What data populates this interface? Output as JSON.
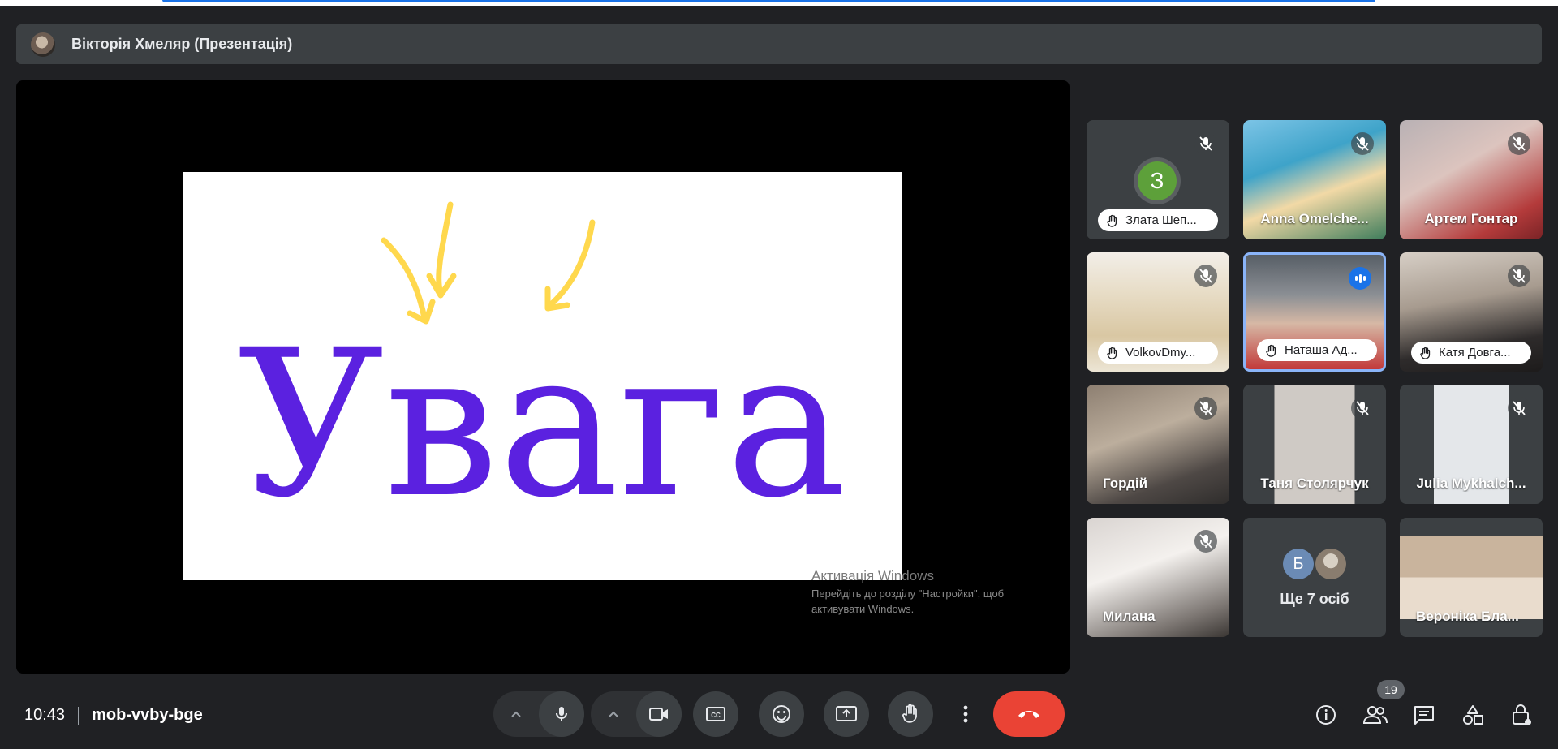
{
  "presenter": {
    "name": "Вікторія Хмеляр (Презентація)"
  },
  "slide": {
    "word": "Увага",
    "word_color": "#5b21e0",
    "arrow_color": "#ffd84d"
  },
  "watermark": {
    "title": "Активація Windows",
    "line1": "Перейдіть до розділу \"Настройки\", щоб",
    "line2": "активувати Windows."
  },
  "participants": [
    {
      "name": "Злата Шеп...",
      "initial": "З",
      "hand": true,
      "muted": true
    },
    {
      "name": "Anna Omelche...",
      "hand": false,
      "muted": true
    },
    {
      "name": "Артем Гонтар",
      "hand": false,
      "muted": true
    },
    {
      "name": "VolkovDmy...",
      "hand": true,
      "muted": true
    },
    {
      "name": "Наташа Ад...",
      "hand": true,
      "speaking": true
    },
    {
      "name": "Катя Довга...",
      "hand": true,
      "muted": true
    },
    {
      "name": "Гордій",
      "hand": false,
      "muted": true
    },
    {
      "name": "Таня Столярчук",
      "hand": false,
      "muted": true
    },
    {
      "name": "Julia Mykhalch...",
      "hand": false,
      "muted": true
    },
    {
      "name": "Милана",
      "hand": false,
      "muted": true
    },
    {
      "more_label": "Ще 7 осіб",
      "more_initial": "Б"
    },
    {
      "name": "Вероніка Бла...",
      "hand": false,
      "muted": false
    }
  ],
  "meeting": {
    "time": "10:43",
    "code": "mob-vvby-bge"
  },
  "people_count": "19",
  "icons": {
    "mic": "microphone-icon",
    "camera": "videocam-icon",
    "captions": "closed-caption-icon",
    "emoji": "emoji-icon",
    "present": "present-screen-icon",
    "hand": "raise-hand-icon",
    "more": "more-vert-icon",
    "end": "call-end-icon",
    "info": "info-icon",
    "people": "people-icon",
    "chat": "chat-icon",
    "activities": "activities-icon",
    "lock": "host-controls-icon"
  }
}
